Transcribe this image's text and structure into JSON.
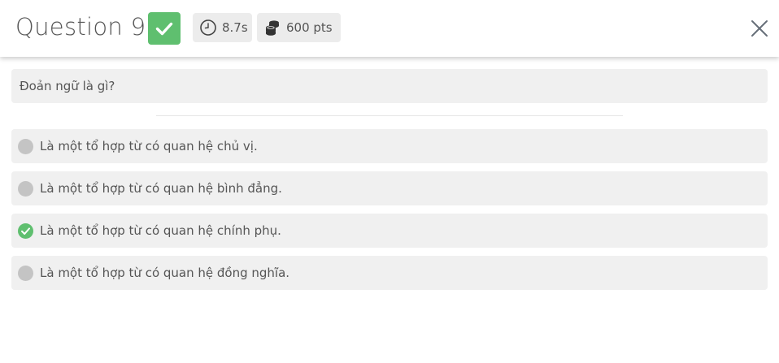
{
  "header": {
    "title": "Question 9",
    "status_icon": "check-icon",
    "status_color": "#5fbf6f",
    "time": "8.7s",
    "time_icon": "clock-icon",
    "points": "600 pts",
    "points_icon": "coins-icon",
    "close_icon": "close-icon"
  },
  "question": {
    "text": "Đoản ngữ là gì?"
  },
  "options": [
    {
      "label": "Là một tổ hợp từ có quan hệ chủ vị.",
      "state": "unselected"
    },
    {
      "label": "Là một tổ hợp từ có quan hệ bình đẳng.",
      "state": "unselected"
    },
    {
      "label": "Là một tổ hợp từ có quan hệ chính phụ.",
      "state": "correct"
    },
    {
      "label": "Là một tổ hợp từ có quan hệ đồng nghĩa.",
      "state": "unselected"
    }
  ]
}
